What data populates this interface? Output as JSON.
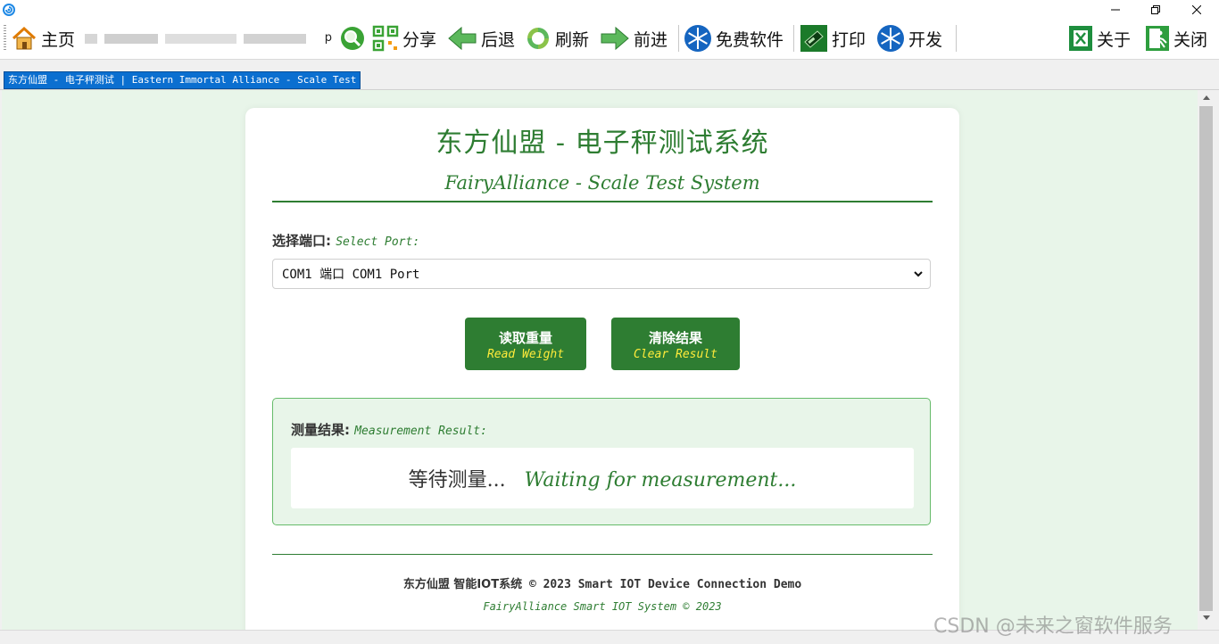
{
  "toolbar": {
    "home": "主页",
    "url_tail": "p",
    "share": "分享",
    "back": "后退",
    "refresh": "刷新",
    "forward": "前进",
    "free_software": "免费软件",
    "print": "打印",
    "develop": "开发",
    "about": "关于",
    "close": "关闭"
  },
  "tab": {
    "title": "东方仙盟 - 电子秤测试 | Eastern Immortal Alliance - Scale Test"
  },
  "page": {
    "title": "东方仙盟 - 电子秤测试系统",
    "subtitle": "FairyAlliance - Scale Test System",
    "port_label_cn": "选择端口:",
    "port_label_en": "Select Port:",
    "port_selected": "COM1 端口 COM1 Port",
    "read_cn": "读取重量",
    "read_en": "Read Weight",
    "clear_cn": "清除结果",
    "clear_en": "Clear Result",
    "result_label_cn": "测量结果:",
    "result_label_en": "Measurement Result:",
    "result_cn": "等待测量...",
    "result_en": "Waiting for measurement...",
    "footer_cn": "东方仙盟 智能IOT系统",
    "footer_en": "© 2023 Smart IOT Device Connection Demo",
    "footer_line2": "FairyAlliance Smart IOT System © 2023"
  },
  "watermark": "CSDN @未来之窗软件服务",
  "colors": {
    "accent": "#2e7d32",
    "background": "#e8f5e9",
    "button_subtext": "#ffeb3b",
    "tab_active": "#0b6fd0"
  },
  "icons": {
    "app": "globe-icon",
    "home": "house-icon",
    "search": "magnifier-icon",
    "share": "qr-code-icon",
    "back": "arrow-left-icon",
    "refresh": "recycle-icon",
    "forward": "arrow-right-icon",
    "free_software": "snowflake-icon",
    "print": "printer-icon",
    "develop": "snowflake-icon",
    "about": "excel-icon",
    "close": "exit-icon"
  }
}
